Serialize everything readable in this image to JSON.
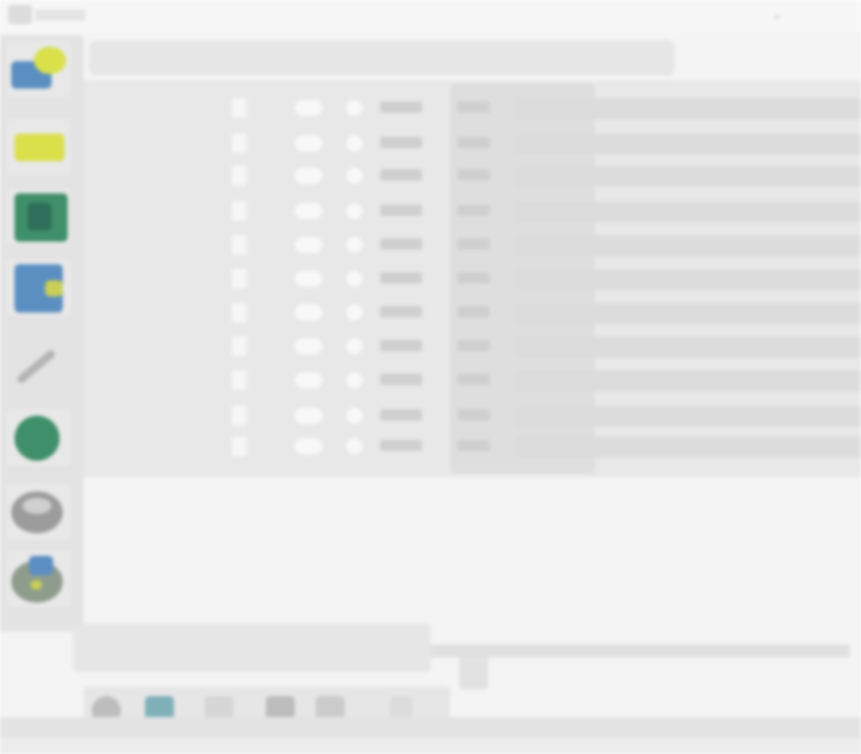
{
  "window": {
    "menu_icon": "menu-icon",
    "title": "",
    "close_glyph": "✕"
  },
  "dock": {
    "items": [
      {
        "name": "weather-app-icon"
      },
      {
        "name": "stack-app-icon"
      },
      {
        "name": "spreadsheet-app-icon"
      },
      {
        "name": "document-app-icon"
      },
      {
        "name": "pen-tool-icon"
      },
      {
        "name": "globe-icon"
      },
      {
        "name": "cloud-icon"
      },
      {
        "name": "photo-app-icon"
      }
    ]
  },
  "toolbar": {
    "items": [
      "",
      "",
      "",
      "",
      "",
      "",
      "",
      ""
    ]
  },
  "table": {
    "rows": [
      {
        "name": "",
        "a": "",
        "b": "",
        "status": "",
        "value": ""
      },
      {
        "name": "",
        "a": "",
        "b": "",
        "status": "",
        "value": ""
      },
      {
        "name": "",
        "a": "",
        "b": "",
        "status": "",
        "value": ""
      },
      {
        "name": "",
        "a": "",
        "b": "",
        "status": "",
        "value": ""
      },
      {
        "name": "",
        "a": "",
        "b": "",
        "status": "",
        "value": ""
      },
      {
        "name": "",
        "a": "",
        "b": "",
        "status": "",
        "value": ""
      },
      {
        "name": "",
        "a": "",
        "b": "",
        "status": "",
        "value": ""
      },
      {
        "name": "",
        "a": "",
        "b": "",
        "status": "",
        "value": ""
      },
      {
        "name": "",
        "a": "",
        "b": "",
        "status": "",
        "value": ""
      },
      {
        "name": "",
        "a": "",
        "b": "",
        "status": "",
        "value": ""
      },
      {
        "name": "",
        "a": "",
        "b": "",
        "status": "",
        "value": ""
      }
    ]
  },
  "bottom_tabs": {
    "items": [
      "",
      "",
      "",
      ""
    ]
  },
  "tray": {
    "buttons": [
      "settings-icon",
      "pin-icon",
      "home-icon",
      "calendar-icon",
      "chart-icon",
      "more-icon"
    ]
  },
  "status": {
    "items": [
      "",
      "",
      "",
      "",
      ""
    ]
  },
  "colors": {
    "accent_yellow": "#d9e04a",
    "accent_green": "#3f8f6a",
    "accent_blue": "#5b8fc2",
    "panel_gray": "#e6e6e6"
  }
}
